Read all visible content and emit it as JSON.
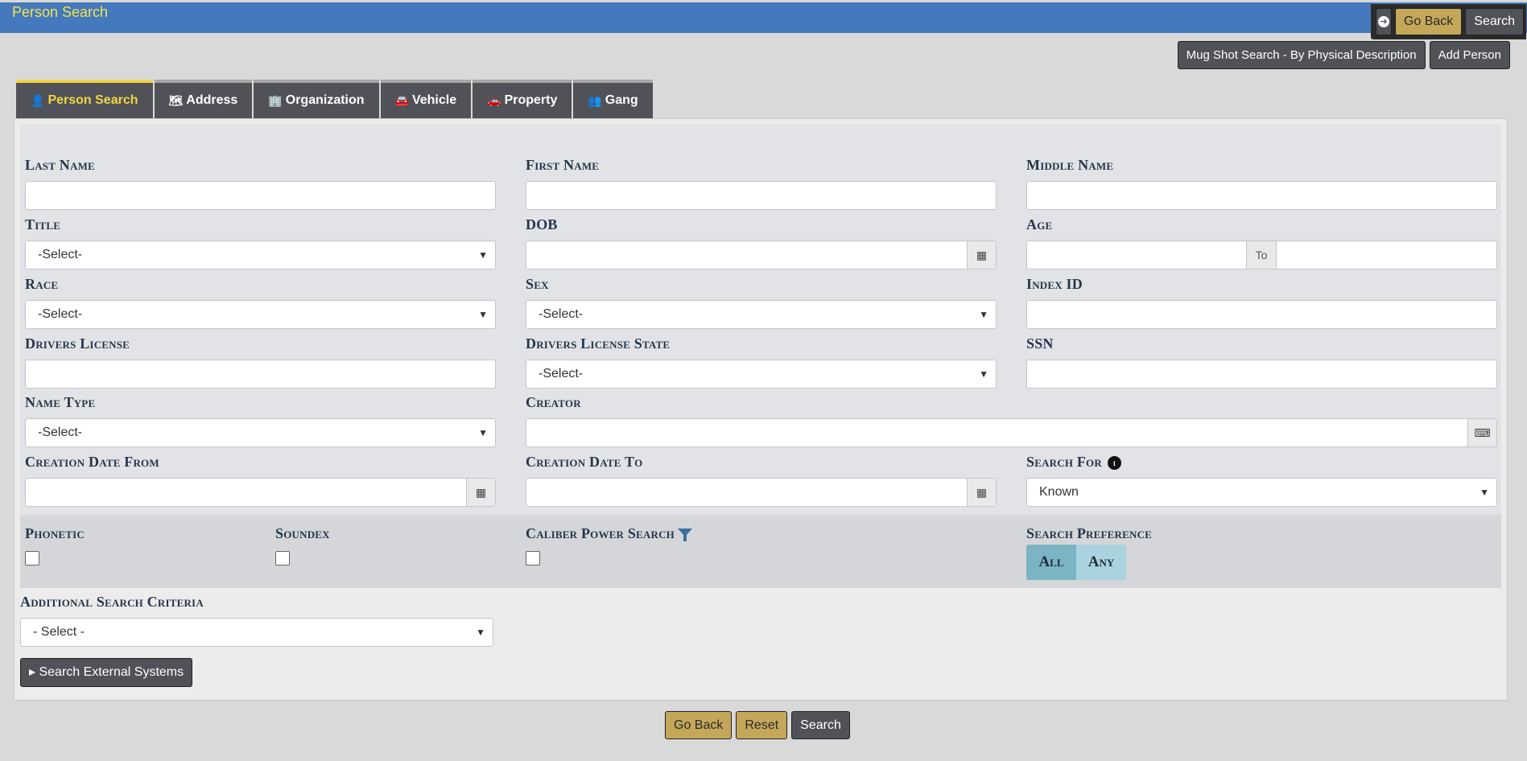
{
  "header": {
    "title": "Person Search",
    "go_back": "Go Back",
    "search": "Search"
  },
  "actions": {
    "mugshot": "Mug Shot Search - By Physical Description",
    "add_person": "Add Person"
  },
  "tabs": [
    {
      "label": "Person Search",
      "icon": "user-icon"
    },
    {
      "label": "Address",
      "icon": "map-icon"
    },
    {
      "label": "Organization",
      "icon": "building-icon"
    },
    {
      "label": "Vehicle",
      "icon": "car-icon"
    },
    {
      "label": "Property",
      "icon": "car-burst-icon"
    },
    {
      "label": "Gang",
      "icon": "users-icon"
    }
  ],
  "form": {
    "last_name": "Last Name",
    "first_name": "First Name",
    "middle_name": "Middle Name",
    "title": "Title",
    "title_value": "-Select-",
    "dob": "DOB",
    "age": "Age",
    "age_to": "To",
    "race": "Race",
    "race_value": "-Select-",
    "sex": "Sex",
    "sex_value": "-Select-",
    "index_id": "Index ID",
    "drivers_license": "Drivers License",
    "dl_state": "Drivers License State",
    "dl_state_value": "-Select-",
    "ssn": "SSN",
    "name_type": "Name Type",
    "name_type_value": "-Select-",
    "creator": "Creator",
    "creation_from": "Creation Date From",
    "creation_to": "Creation Date To",
    "search_for": "Search For",
    "search_for_value": "Known",
    "phonetic": "Phonetic",
    "soundex": "Soundex",
    "caliber": "Caliber Power Search",
    "search_pref": "Search Preference",
    "pref_all": "All",
    "pref_any": "Any",
    "additional": "Additional Search Criteria",
    "additional_value": "- Select -",
    "external": "Search External Systems"
  },
  "footer": {
    "go_back": "Go Back",
    "reset": "Reset",
    "search": "Search"
  }
}
